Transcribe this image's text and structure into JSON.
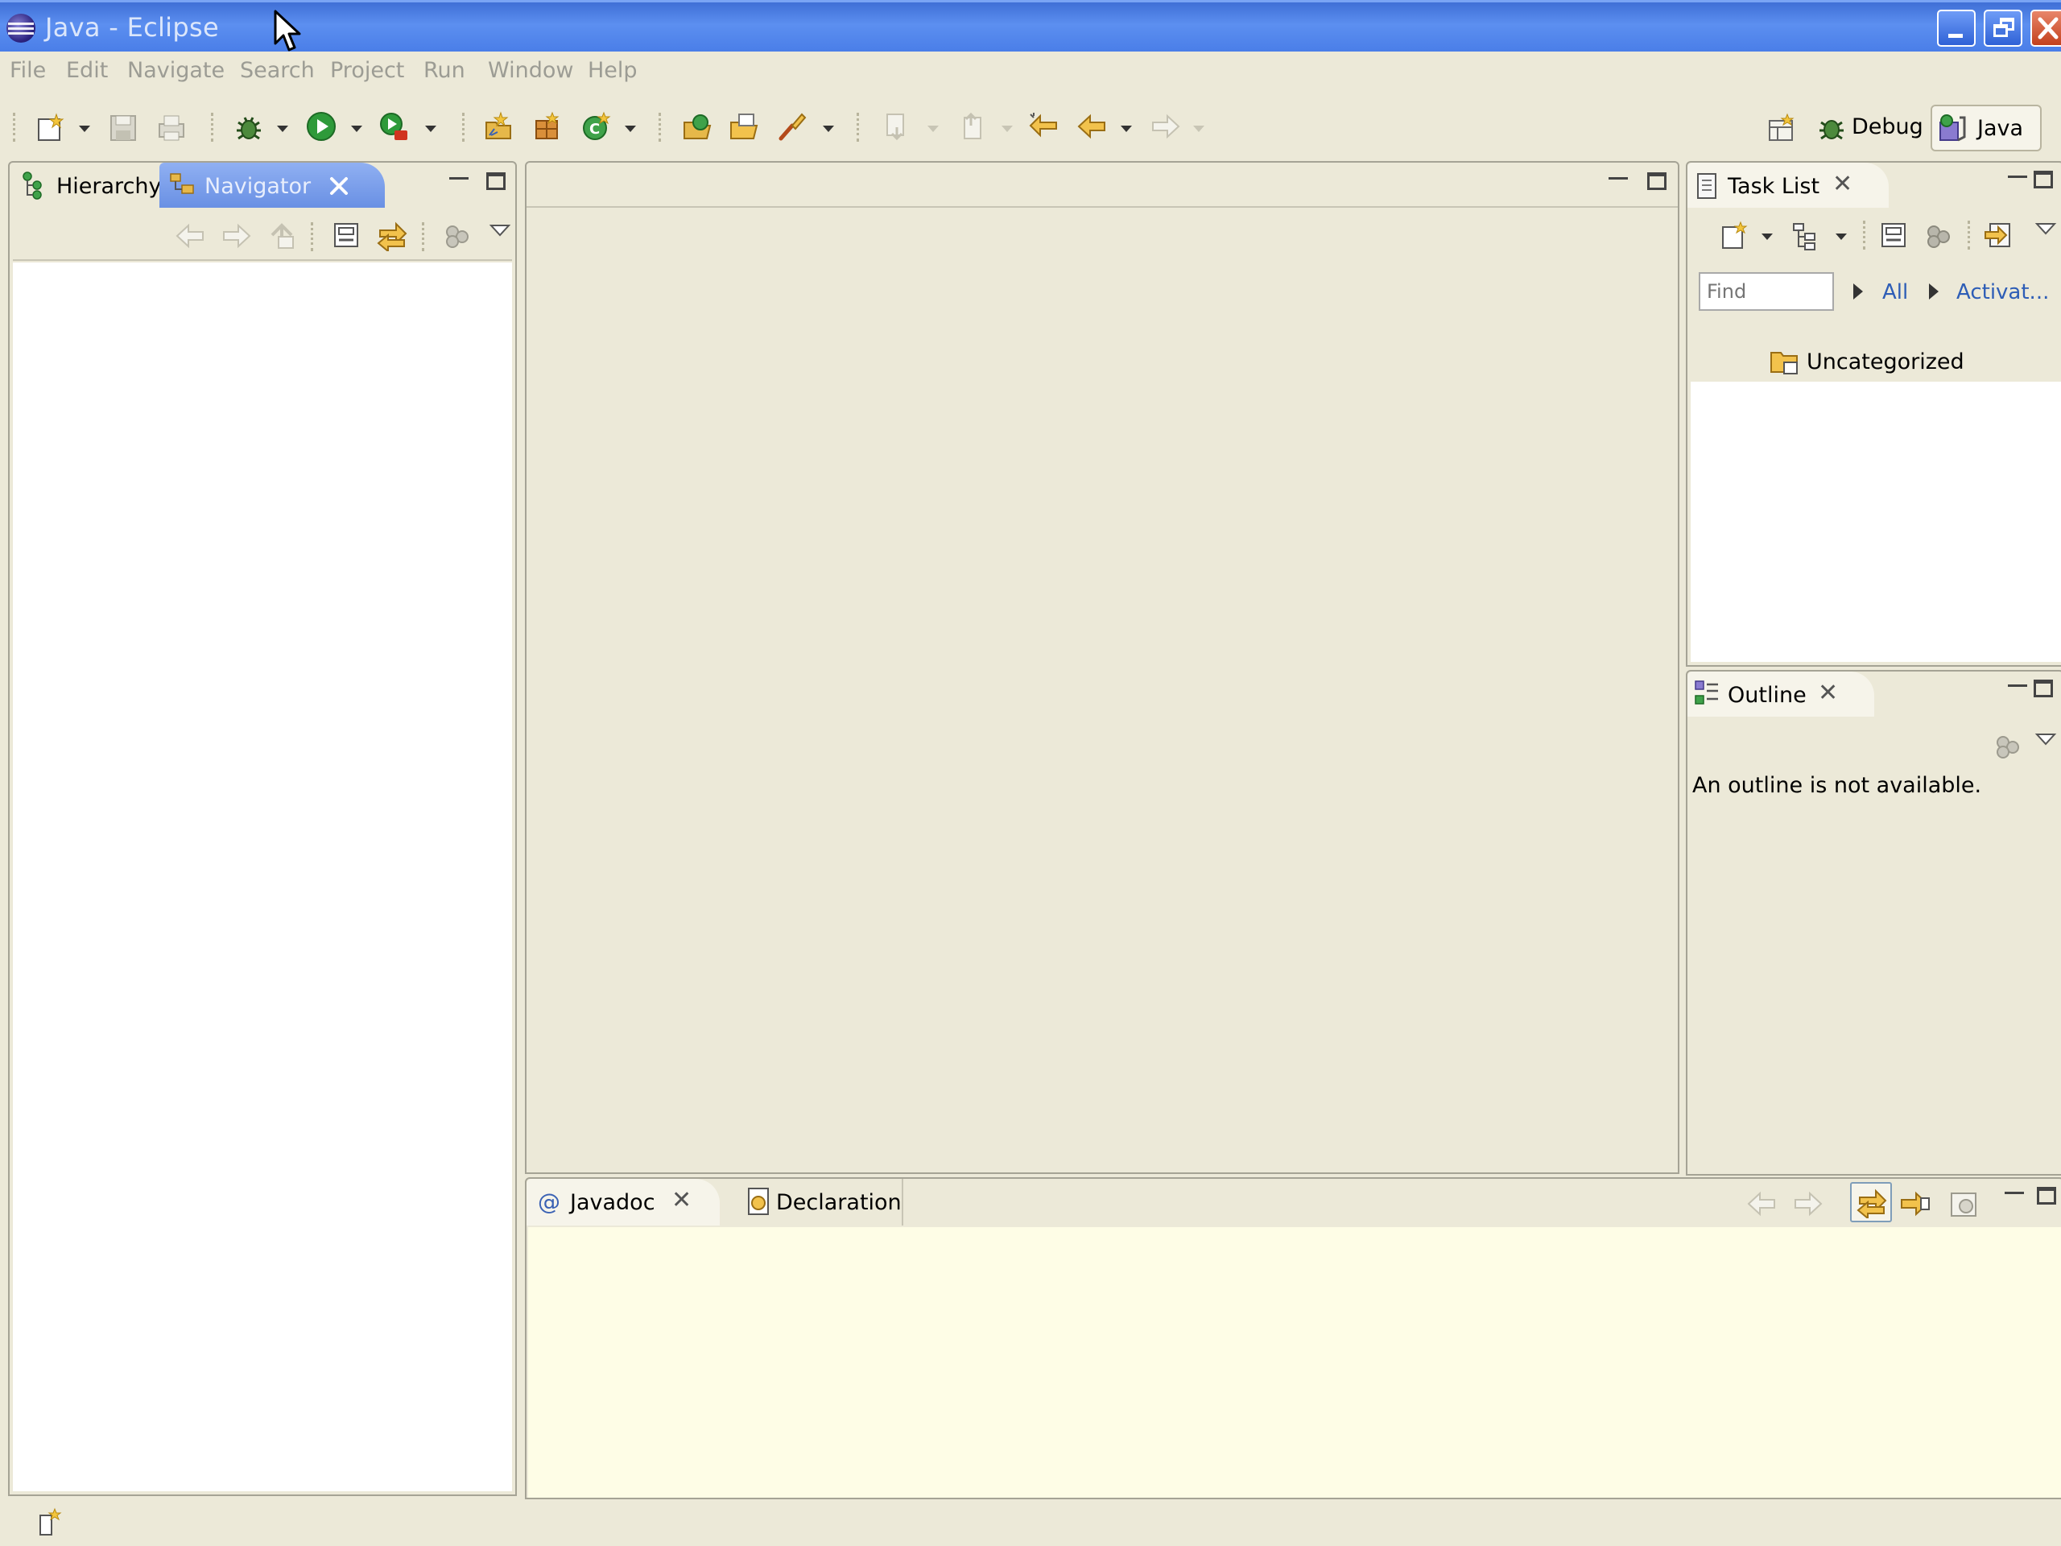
{
  "window": {
    "title": "Java - Eclipse",
    "controls": [
      "minimize",
      "restore",
      "close"
    ]
  },
  "menu": {
    "items": [
      "File",
      "Edit",
      "Navigate",
      "Search",
      "Project",
      "Run",
      "Window",
      "Help"
    ]
  },
  "perspectives": {
    "debug_label": "Debug",
    "java_label": "Java",
    "active": "Java"
  },
  "left_panel": {
    "tabs": [
      {
        "label": "Hierarchy",
        "active": false
      },
      {
        "label": "Navigator",
        "active": true
      }
    ]
  },
  "tasklist": {
    "tab_label": "Task List",
    "find_placeholder": "Find",
    "filter_all": "All",
    "filter_activate": "Activat...",
    "categories": [
      "Uncategorized"
    ]
  },
  "outline": {
    "tab_label": "Outline",
    "message": "An outline is not available."
  },
  "bottom_panel": {
    "tabs": [
      {
        "label": "Javadoc",
        "active": true
      },
      {
        "label": "Declaration",
        "active": false
      }
    ]
  },
  "colors": {
    "window_background": "#ece9d8",
    "titlebar_blue": "#4a7ee8",
    "active_tab_blue": "#7a9de8",
    "javadoc_background": "#fefde6",
    "link_blue": "#2d5db6"
  },
  "icons": [
    "eclipse-logo-icon",
    "new-wizard-icon",
    "save-icon",
    "print-icon",
    "debug-icon",
    "run-icon",
    "external-tools-icon",
    "new-java-project-icon",
    "new-package-icon",
    "new-class-icon",
    "open-type-icon",
    "open-task-icon",
    "search-icon",
    "next-annotation-icon",
    "previous-annotation-icon",
    "last-edit-location-icon",
    "back-icon",
    "forward-icon"
  ]
}
